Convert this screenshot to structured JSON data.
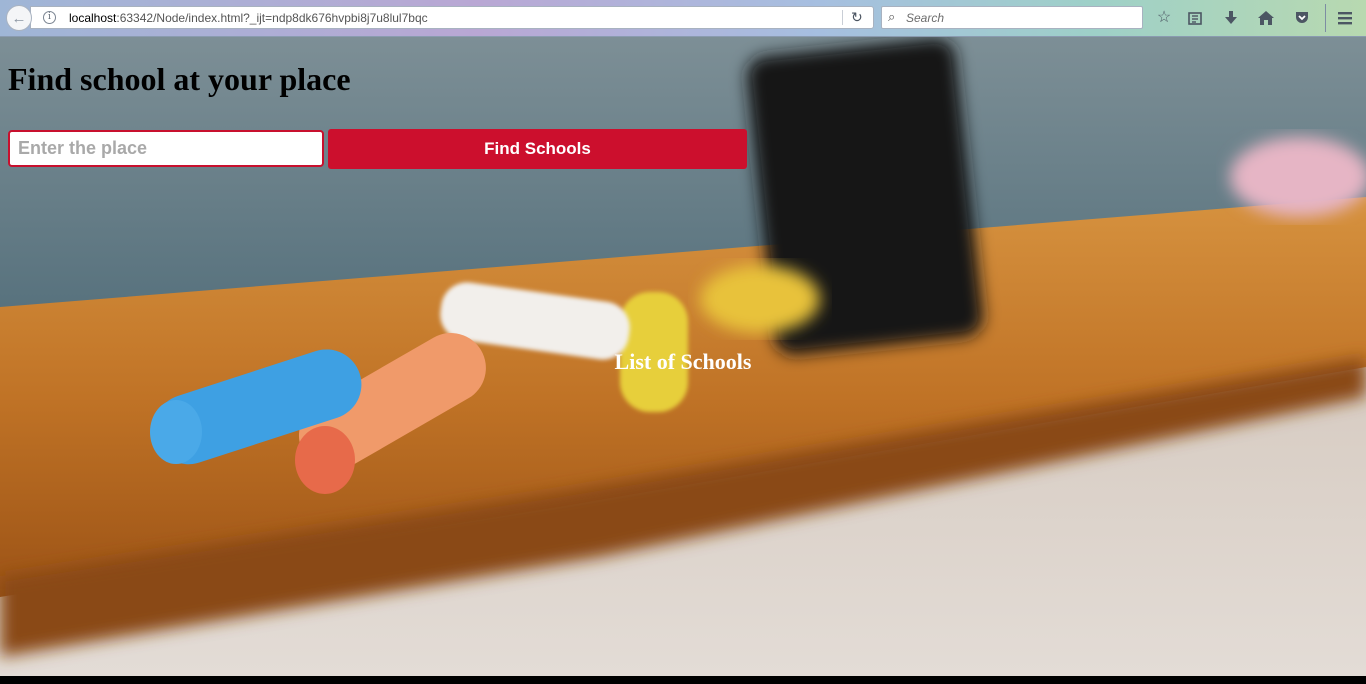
{
  "browser": {
    "url_host": "localhost",
    "url_rest": ":63342/Node/index.html?_ijt=ndp8dk676hvpbi8j7u8lul7bqc",
    "search_placeholder": "Search"
  },
  "page": {
    "title": "Find school at your place",
    "place_placeholder": "Enter the place",
    "find_button": "Find Schools",
    "list_title": "List of Schools"
  },
  "colors": {
    "accent": "#cc0f2d"
  }
}
